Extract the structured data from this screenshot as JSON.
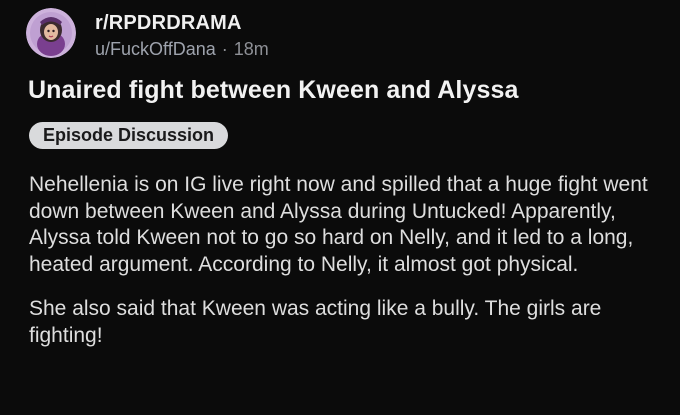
{
  "post": {
    "subreddit": "r/RPDRDRAMA",
    "username": "u/FuckOffDana",
    "separator": "·",
    "age": "18m",
    "title": "Unaired fight between Kween and Alyssa",
    "flair": "Episode Discussion",
    "paragraphs": [
      "Nehellenia is on IG live right now and spilled that a huge fight went down between Kween and Alyssa during Untucked! Apparently, Alyssa told Kween not to go so hard on Nelly, and it led to a long, heated argument. According to Nelly, it almost got physical.",
      "She also said that Kween was acting like a bully. The girls are fighting!"
    ]
  },
  "colors": {
    "background": "#0b0b0b",
    "text": "#dedede",
    "muted": "#8e9096",
    "flair_bg": "#d9dadc",
    "avatar_bg": "#c9a8d8"
  },
  "icons": {
    "avatar": "subreddit-avatar-icon"
  }
}
